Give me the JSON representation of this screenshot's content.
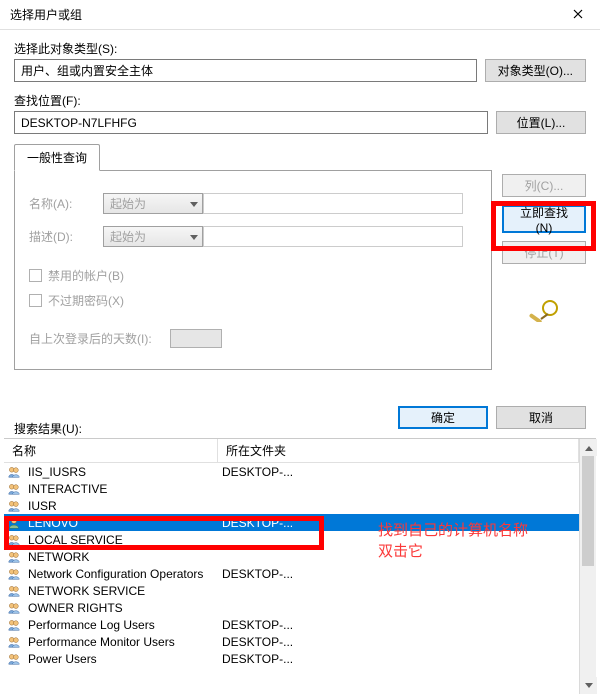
{
  "window": {
    "title": "选择用户或组"
  },
  "object_type": {
    "label": "选择此对象类型(S):",
    "value": "用户、组或内置安全主体",
    "button": "对象类型(O)..."
  },
  "location": {
    "label": "查找位置(F):",
    "value": "DESKTOP-N7LFHFG",
    "button": "位置(L)..."
  },
  "tab": {
    "label": "一般性查询",
    "name_label": "名称(A):",
    "name_mode": "起始为",
    "desc_label": "描述(D):",
    "desc_mode": "起始为",
    "chk_disabled": "禁用的帐户(B)",
    "chk_noexpire": "不过期密码(X)",
    "days_label": "自上次登录后的天数(I):"
  },
  "right_buttons": {
    "columns": "列(C)...",
    "find_now": "立即查找(N)",
    "stop": "停止(T)"
  },
  "dialog_buttons": {
    "ok": "确定",
    "cancel": "取消"
  },
  "results": {
    "label": "搜索结果(U):",
    "col_name": "名称",
    "col_folder": "所在文件夹",
    "rows": [
      {
        "type": "group",
        "name": "IIS_IUSRS",
        "folder": "DESKTOP-...",
        "selected": false
      },
      {
        "type": "group",
        "name": "INTERACTIVE",
        "folder": "",
        "selected": false
      },
      {
        "type": "group",
        "name": "IUSR",
        "folder": "",
        "selected": false
      },
      {
        "type": "user",
        "name": "LENOVO",
        "folder": "DESKTOP-...",
        "selected": true
      },
      {
        "type": "group",
        "name": "LOCAL SERVICE",
        "folder": "",
        "selected": false
      },
      {
        "type": "group",
        "name": "NETWORK",
        "folder": "",
        "selected": false
      },
      {
        "type": "group",
        "name": "Network Configuration Operators",
        "folder": "DESKTOP-...",
        "selected": false
      },
      {
        "type": "group",
        "name": "NETWORK SERVICE",
        "folder": "",
        "selected": false
      },
      {
        "type": "group",
        "name": "OWNER RIGHTS",
        "folder": "",
        "selected": false
      },
      {
        "type": "group",
        "name": "Performance Log Users",
        "folder": "DESKTOP-...",
        "selected": false
      },
      {
        "type": "group",
        "name": "Performance Monitor Users",
        "folder": "DESKTOP-...",
        "selected": false
      },
      {
        "type": "group",
        "name": "Power Users",
        "folder": "DESKTOP-...",
        "selected": false
      }
    ]
  },
  "annotation": {
    "line1": "找到自己的计算机名称",
    "line2": "双击它"
  }
}
